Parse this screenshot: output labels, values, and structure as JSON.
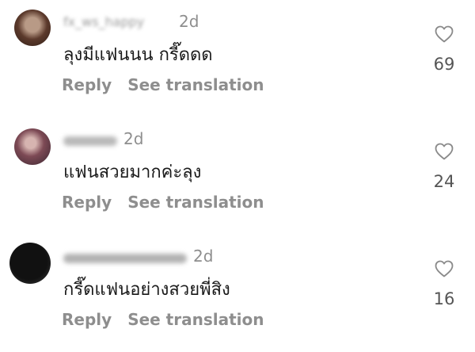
{
  "comments": [
    {
      "username": "fx_ws_happy",
      "time": "2d",
      "text": "ลุงมีแฟนนน กรี๊ดดด",
      "reply_label": "Reply",
      "translate_label": "See translation",
      "likes": "69"
    },
    {
      "username": "",
      "time": "2d",
      "text": "แฟนสวยมากค่ะลุง",
      "reply_label": "Reply",
      "translate_label": "See translation",
      "likes": "24"
    },
    {
      "username": "",
      "time": "2d",
      "text": "กรี๊ดแฟนอย่างสวยพี่สิง",
      "reply_label": "Reply",
      "translate_label": "See translation",
      "likes": "16"
    }
  ],
  "icons": {
    "like": "heart-outline-icon"
  },
  "colors": {
    "text": "#1a1a1a",
    "meta": "#8e8e8e",
    "likes": "#555555"
  }
}
